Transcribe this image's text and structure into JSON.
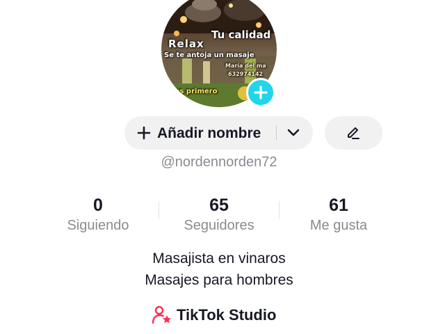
{
  "avatar": {
    "overlay_lines": [
      "Tu calidad",
      "Relax",
      "Se te antoja un masaje",
      "María del ma",
      "632974142",
      "eres primero"
    ],
    "add_icon": "plus-icon",
    "add_button_color": "#20d5ec"
  },
  "profile": {
    "add_name_label": "Añadir nombre",
    "username": "@nordennorden72"
  },
  "stats": [
    {
      "value": "0",
      "label": "Siguiendo"
    },
    {
      "value": "65",
      "label": "Seguidores"
    },
    {
      "value": "61",
      "label": "Me gusta"
    }
  ],
  "bio": {
    "lines": [
      "Masajista en vinaros",
      "Masajes para hombres"
    ]
  },
  "studio": {
    "label": "TikTok Studio",
    "icon": "person-star-icon",
    "icon_color": "#fe2c55"
  },
  "icons": {
    "add_name": "plus-icon",
    "dropdown": "chevron-down-icon",
    "edit": "pencil-icon"
  }
}
